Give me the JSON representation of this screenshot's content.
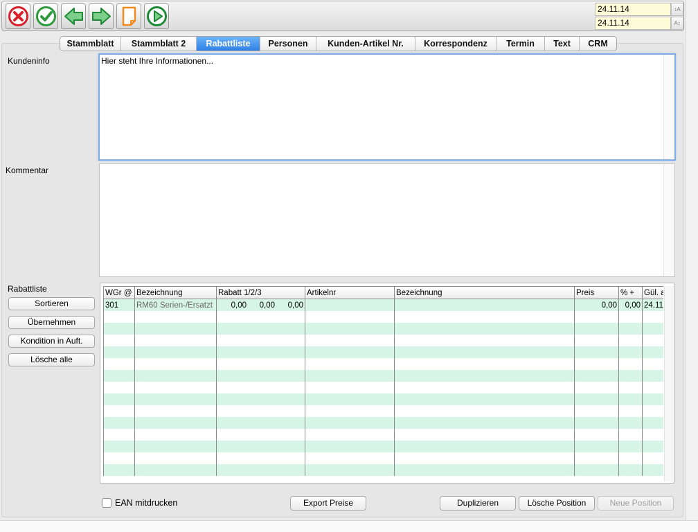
{
  "toolbar": {
    "buttons": [
      {
        "icon": "cancel-icon",
        "color": "#d8202a"
      },
      {
        "icon": "check-icon",
        "color": "#2e9a3c"
      },
      {
        "icon": "arrow-left-icon",
        "color": "#2ea34a"
      },
      {
        "icon": "arrow-right-icon",
        "color": "#2ea34a"
      },
      {
        "icon": "new-document-icon",
        "color": "#f28a1e"
      },
      {
        "icon": "play-icon",
        "color": "#2ea34a"
      }
    ],
    "date1": "24.11.14",
    "date2": "24.11.14"
  },
  "tabs": [
    "Stammblatt",
    "Stammblatt 2",
    "Rabattliste",
    "Personen",
    "Kunden-Artikel Nr.",
    "Korrespondenz",
    "Termin",
    "Text",
    "CRM"
  ],
  "active_tab": "Rabattliste",
  "kundeninfo": {
    "label": "Kundeninfo",
    "value": "Hier steht Ihre Informationen..."
  },
  "kommentar": {
    "label": "Kommentar",
    "value": ""
  },
  "rabattliste": {
    "label": "Rabattliste",
    "side_buttons": [
      "Sortieren",
      "Übernehmen",
      "Kondition in Auft.",
      "Lösche alle"
    ],
    "columns": [
      "WGr @",
      "Bezeichnung",
      "Rabatt 1/2/3",
      "Artikelnr",
      "Bezeichnung",
      "Preis",
      "% +",
      "Gül. a"
    ],
    "rows": [
      {
        "wgr": "301",
        "bezeichnung": "RM60 Serien-/Ersatzt",
        "rabatt1": "0,00",
        "rabatt2": "0,00",
        "rabatt3": "0,00",
        "artikelnr": "",
        "bezeichnung2": "",
        "preis": "0,00",
        "prozent": "0,00",
        "gueltig": "24.11"
      }
    ]
  },
  "bottom": {
    "ean_label": "EAN mitdrucken",
    "export_label": "Export Preise",
    "duplizieren_label": "Duplizieren",
    "loesche_position_label": "Lösche Position",
    "neue_position_label": "Neue Position"
  },
  "colors": {
    "active_tab": "#2f80e6",
    "row_alt": "#d7f5e6",
    "date_bg": "#fffcd9",
    "focus": "#7faee5"
  }
}
